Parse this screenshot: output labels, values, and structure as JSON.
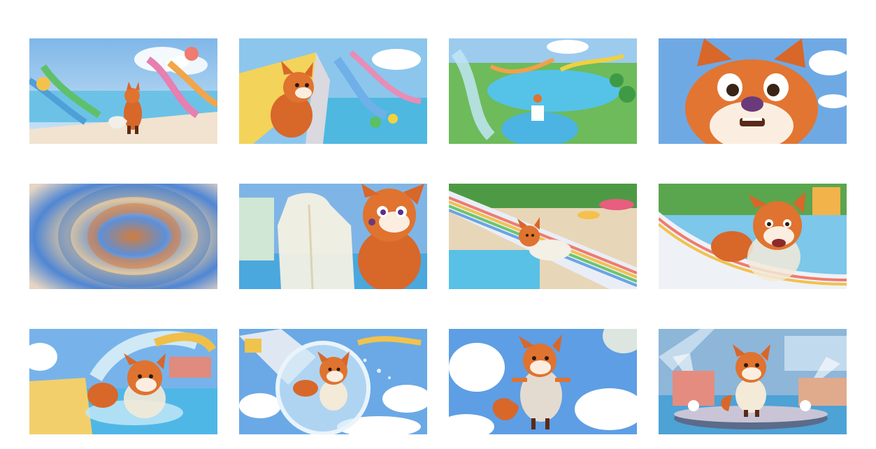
{
  "storyboard": {
    "frames": [
      {
        "id": 1,
        "scene": "fox-standing-at-waterpark-walkway"
      },
      {
        "id": 2,
        "scene": "fox-on-yellow-slide-top-view"
      },
      {
        "id": 3,
        "scene": "aerial-view-waterpark-pools"
      },
      {
        "id": 4,
        "scene": "fox-closeup-nervous-face"
      },
      {
        "id": 5,
        "scene": "motion-blur-swirl"
      },
      {
        "id": 6,
        "scene": "fox-with-clear-raincoat"
      },
      {
        "id": 7,
        "scene": "fox-sliding-rainbow-slide"
      },
      {
        "id": 8,
        "scene": "fox-in-raincoat-cheering-on-slide"
      },
      {
        "id": 9,
        "scene": "fox-splashing-into-pool"
      },
      {
        "id": 10,
        "scene": "fox-inside-clear-tube"
      },
      {
        "id": 11,
        "scene": "fox-floating-in-sky"
      },
      {
        "id": 12,
        "scene": "fox-on-stage-with-spotlights"
      }
    ]
  }
}
